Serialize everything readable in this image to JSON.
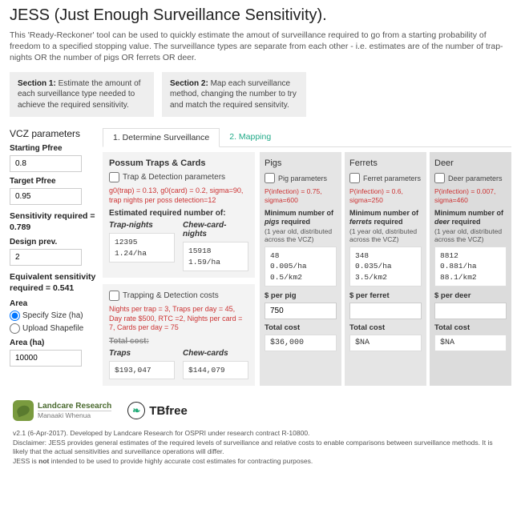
{
  "title": "JESS (Just Enough Surveillance Sensitivity).",
  "intro": "This 'Ready-Reckoner' tool can be used to quickly estimate the amout of surveillance required to go from a starting probability of freedom to a specified stopping value. The surveillance types are separate from each other - i.e. estimates are of the number of trap-nights OR the number of pigs OR ferrets OR deer.",
  "section1": {
    "label": "Section 1:",
    "text": " Estimate the amount of each surveillance type needed to achieve the required sensitivity."
  },
  "section2": {
    "label": "Section 2:",
    "text": " Map each surveillance method, changing the number to try and match the required sensitvity."
  },
  "sidebar": {
    "heading": "VCZ parameters",
    "starting_pfree_label": "Starting Pfree",
    "starting_pfree": "0.8",
    "target_pfree_label": "Target Pfree",
    "target_pfree": "0.95",
    "sensitivity_calc": "Sensitivity required = 0.789",
    "design_prev_label": "Design prev.",
    "design_prev": "2",
    "equiv_calc": "Equivalent sensitivity required = 0.541",
    "area_label": "Area",
    "radio1": "Specify Size (ha)",
    "radio2": "Upload Shapefile",
    "area_ha_label": "Area (ha)",
    "area_ha": "10000"
  },
  "tabs": {
    "t1": "1. Determine Surveillance",
    "t2": "2. Mapping"
  },
  "possum": {
    "title": "Possum Traps & Cards",
    "check": "Trap & Detection parameters",
    "red": "g0(trap) = 0.13, g0(card) = 0.2, sigma=90, trap nights per poss detection=12",
    "est": "Estimated required number of:",
    "col1_hdr": "Trap-nights",
    "col2_hdr": "Chew-card-nights",
    "trap_val": "12395\n1.24/ha",
    "card_val": "15918\n1.59/ha"
  },
  "costs": {
    "check": "Trapping & Detection costs",
    "red": "Nights per trap = 3, Traps per day = 45, Day rate $500, RTC =2, Nights per card = 7, Cards per day = 75",
    "total_label": "Total cost:",
    "col1_hdr": "Traps",
    "col2_hdr": "Chew-cards",
    "traps_val": "$193,047",
    "cards_val": "$144,079"
  },
  "pigs": {
    "title": "Pigs",
    "check": "Pig parameters",
    "red": "P(infection) = 0.75, sigma=600",
    "min_b": "Minimum number of ",
    "min_i": "pigs",
    "min_e": " required",
    "min_note": "(1 year old, distributed across the VCZ)",
    "val": "48\n0.005/ha\n0.5/km2",
    "per_label": "$ per pig",
    "per_val": "750",
    "total_label": "Total cost",
    "total": "$36,000"
  },
  "ferrets": {
    "title": "Ferrets",
    "check": "Ferret parameters",
    "red": "P(infection) = 0.6, sigma=250",
    "min_b": "Minimum number of ",
    "min_i": "ferrets",
    "min_e": " required",
    "min_note": "(1 year old, distributed across the VCZ)",
    "val": "348\n0.035/ha\n3.5/km2",
    "per_label": "$ per ferret",
    "per_val": "",
    "total_label": "Total cost",
    "total": "$NA"
  },
  "deer": {
    "title": "Deer",
    "check": "Deer parameters",
    "red": "P(infection) = 0.007, sigma=460",
    "min_b": "Minimum number of ",
    "min_i": "deer",
    "min_e": " required",
    "min_note": "(1 year old, distributed across the VCZ)",
    "val": "8812\n0.881/ha\n88.1/km2",
    "per_label": "$ per deer",
    "per_val": "",
    "total_label": "Total cost",
    "total": "$NA"
  },
  "footer": {
    "lc1": "Landcare Research",
    "lc2": "Manaaki Whenua",
    "tb": "TBfree",
    "l1": "v2.1 (6-Apr-2017). Developed by Landcare Research for OSPRI under research contract R-10800.",
    "l2a": "Disclaimer: JESS provides general estimates of the required levels of surveillance and relative costs to enable comparisons between surveillance methods. It is likely that the actual sensitivities and surveillance operations will differ.",
    "l2b": "JESS is ",
    "l2c": "not",
    "l2d": " intended to be used to provide highly accurate cost estimates for contracting purposes."
  }
}
